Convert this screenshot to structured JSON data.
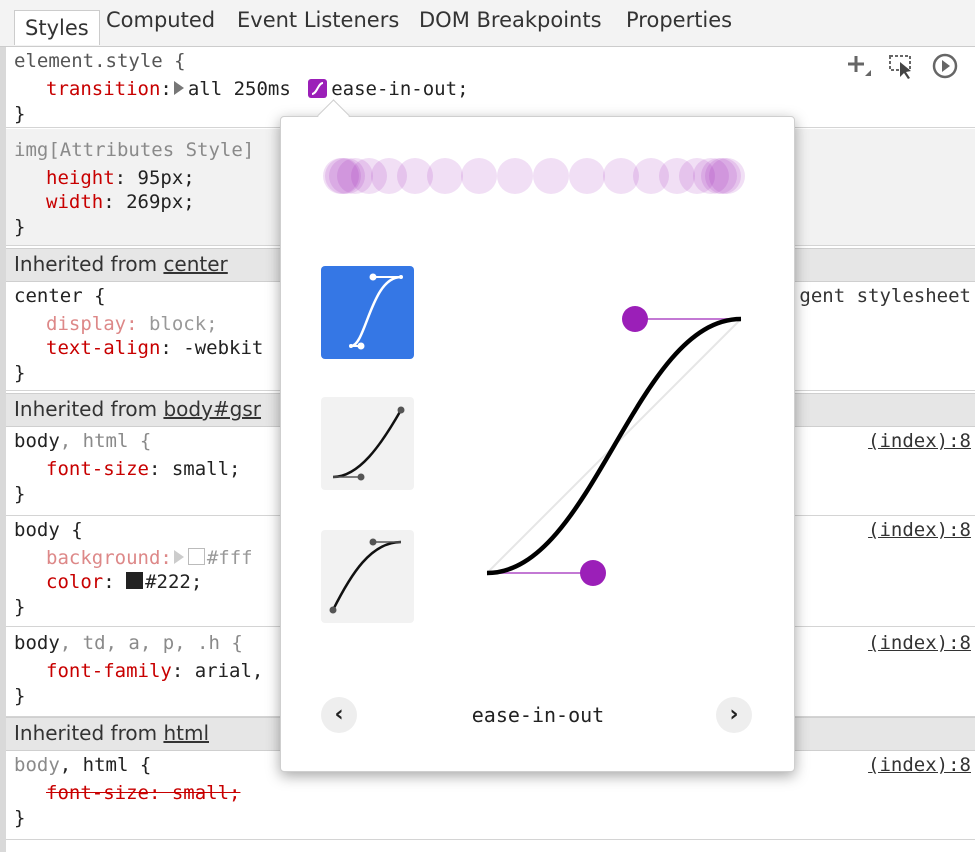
{
  "tabs": [
    "Styles",
    "Computed",
    "Event Listeners",
    "DOM Breakpoints",
    "Properties"
  ],
  "element_style": {
    "selector": "element.style {",
    "prop": "transition",
    "value_pre": "all 250ms ",
    "value_post": "ease-in-out;",
    "close": "}"
  },
  "img_attr": {
    "selector": "img[Attributes Style]",
    "props": [
      {
        "name": "height",
        "value": "95px;"
      },
      {
        "name": "width",
        "value": "269px;"
      }
    ],
    "close": "}"
  },
  "inherited_center": {
    "label": "Inherited from ",
    "link": "center"
  },
  "center_rule": {
    "selector": "center {",
    "src": "gent stylesheet",
    "p1_name": "display",
    "p1_value": "block;",
    "p2_name": "text-align",
    "p2_value": "-webkit",
    "close": "}"
  },
  "inherited_body": {
    "label": "Inherited from ",
    "link": "body#gsr"
  },
  "body_html_rule": {
    "sel_a": "body",
    "sel_b": ", html {",
    "src": "(index):8",
    "p1_name": "font-size",
    "p1_value": "small;",
    "close": "}"
  },
  "body_rule": {
    "selector": "body {",
    "src": "(index):8",
    "p1_name": "background",
    "p1_value": "#fff",
    "p2_name": "color",
    "p2_value": "#222;",
    "close": "}"
  },
  "body_td_rule": {
    "sel_a": "body",
    "sel_b": ", td, a, p, .h {",
    "src": "(index):8",
    "p1_name": "font-family",
    "p1_value": "arial,",
    "close": "}"
  },
  "inherited_html": {
    "label": "Inherited from ",
    "link": "html"
  },
  "html_rule": {
    "sel_a": "body",
    "sel_b": ", html {",
    "src": "(index):8",
    "p1_struck": "font-size: small;",
    "close": "}"
  },
  "popover": {
    "curve_name": "ease-in-out",
    "prev": "‹",
    "next": "›",
    "accent": "#9b1fb8",
    "preset_selected_color": "#3577e5"
  },
  "colors": {
    "property": "#c80000",
    "swatch_fff": "#ffffff",
    "swatch_222": "#222222"
  }
}
